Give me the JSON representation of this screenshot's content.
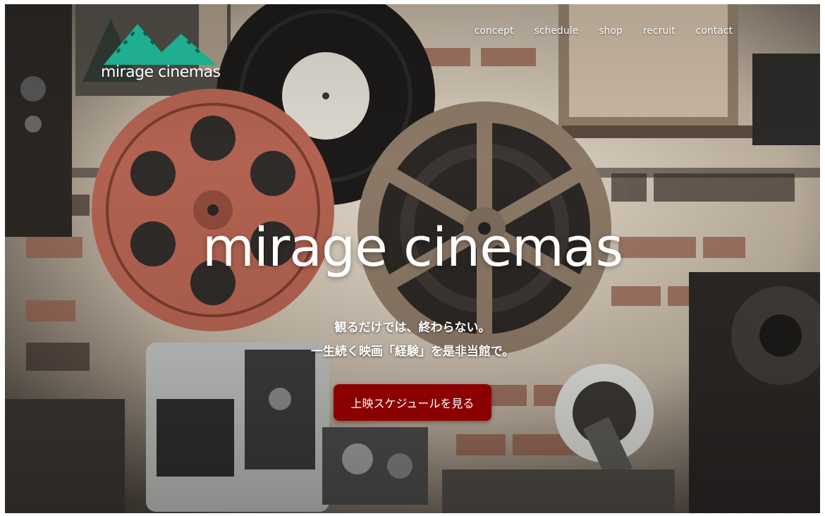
{
  "brand": {
    "logo_text": "mirage cinemas",
    "logo_color": "#1fae8f"
  },
  "nav": {
    "items": [
      "concept",
      "schedule",
      "shop",
      "recruit",
      "contact"
    ]
  },
  "hero": {
    "title": "mirage cinemas",
    "tagline_1": "観るだけでは、終わらない。",
    "tagline_2": "一生続く映画「経験」を是非当館で。",
    "cta_label": "上映スケジュールを見る",
    "cta_color": "#8b0000"
  }
}
